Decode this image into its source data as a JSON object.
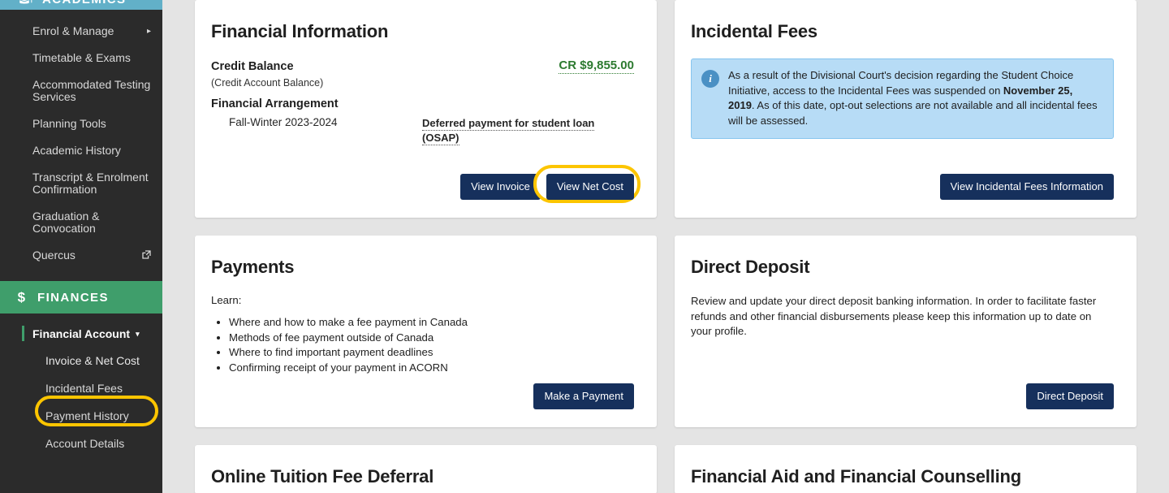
{
  "sidebar": {
    "academics": {
      "label": "ACADEMICS",
      "icon": "graduation-cap-icon",
      "color": "#62b0c8"
    },
    "academics_items": [
      {
        "label": "Enrol & Manage",
        "has_submenu": true,
        "arrow": "▸"
      },
      {
        "label": "Timetable & Exams",
        "has_submenu": false
      },
      {
        "label": "Accommodated Testing Services",
        "has_submenu": false
      },
      {
        "label": "Planning Tools",
        "has_submenu": false
      },
      {
        "label": "Academic History",
        "has_submenu": false
      },
      {
        "label": "Transcript & Enrolment Confirmation",
        "has_submenu": false
      },
      {
        "label": "Graduation & Convocation",
        "has_submenu": false
      },
      {
        "label": "Quercus",
        "has_submenu": false,
        "external": true
      }
    ],
    "finances": {
      "label": "FINANCES",
      "icon": "dollar-sign-icon",
      "color": "#3f9e6b"
    },
    "finances_head": {
      "label": "Financial Account",
      "caret": "▾"
    },
    "finances_items": [
      {
        "label": "Invoice & Net Cost",
        "highlighted": true
      },
      {
        "label": "Incidental Fees",
        "highlighted": false
      },
      {
        "label": "Payment History",
        "highlighted": false
      },
      {
        "label": "Account Details",
        "highlighted": false
      }
    ]
  },
  "annotations": {
    "highlight_color": "#fcc500",
    "sidebar_target": "Invoice & Net Cost",
    "button_target": "View Net Cost"
  },
  "cards": {
    "financial_information": {
      "title": "Financial Information",
      "credit_balance_label": "Credit Balance",
      "credit_balance_sub": "(Credit Account Balance)",
      "credit_balance_value": "CR $9,855.00",
      "credit_balance_color": "#2d7a30",
      "financial_arrangement_label": "Financial Arrangement",
      "term": "Fall-Winter 2023-2024",
      "arrangement": "Deferred payment for student loan (OSAP)",
      "view_invoice_label": "View Invoice",
      "view_net_cost_label": "View Net Cost"
    },
    "incidental_fees": {
      "title": "Incidental Fees",
      "alert_icon": "info-icon",
      "alert_part1": "As a result of the Divisional Court's decision regarding the Student Choice Initiative, access to the Incidental Fees was suspended on ",
      "alert_bold": "November 25, 2019",
      "alert_part2": ". As of this date, opt-out selections are not available and all incidental fees will be assessed.",
      "button_label": "View Incidental Fees Information"
    },
    "payments": {
      "title": "Payments",
      "learn_label": "Learn:",
      "items": [
        "Where and how to make a fee payment in Canada",
        "Methods of fee payment outside of Canada",
        "Where to find important payment deadlines",
        "Confirming receipt of your payment in ACORN"
      ],
      "button_label": "Make a Payment"
    },
    "direct_deposit": {
      "title": "Direct Deposit",
      "body": "Review and update your direct deposit banking information. In order to facilitate faster refunds and other financial disbursements please keep this information up to date on your profile.",
      "button_label": "Direct Deposit"
    },
    "online_tuition_fee_deferral": {
      "title": "Online Tuition Fee Deferral"
    },
    "financial_aid": {
      "title": "Financial Aid and Financial Counselling"
    }
  }
}
